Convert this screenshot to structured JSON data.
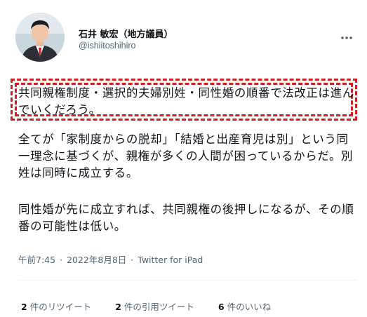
{
  "author": {
    "display_name": "石井 敏宏（地方議員）",
    "handle": "@ishiitoshihiro",
    "avatar_icon": "person-avatar-icon"
  },
  "tweet": {
    "highlighted_line": "共同親権制度・選択的夫婦別姓・同性婚の順番で法改正は進んでいくだろう。",
    "paragraph_1": "全てが「家制度からの脱却」「結婚と出産育児は別」という同一理念に基づくが、親権が多くの人間が困っているからだ。別姓は同時に成立する。",
    "paragraph_2": "同性婚が先に成立すれば、共同親権の後押しになるが、その順番の可能性は低い。",
    "time": "午前7:45",
    "date": "2022年8月8日",
    "separator": "·",
    "source": "Twitter for iPad"
  },
  "stats": {
    "retweets_count": "2",
    "retweets_label": "件のリツイート",
    "quotes_count": "2",
    "quotes_label": "件の引用ツイート",
    "likes_count": "6",
    "likes_label": "件のいいね"
  },
  "colors": {
    "highlight_border": "#d01f1f",
    "secondary_text": "#536471",
    "primary_text": "#0f1419"
  }
}
